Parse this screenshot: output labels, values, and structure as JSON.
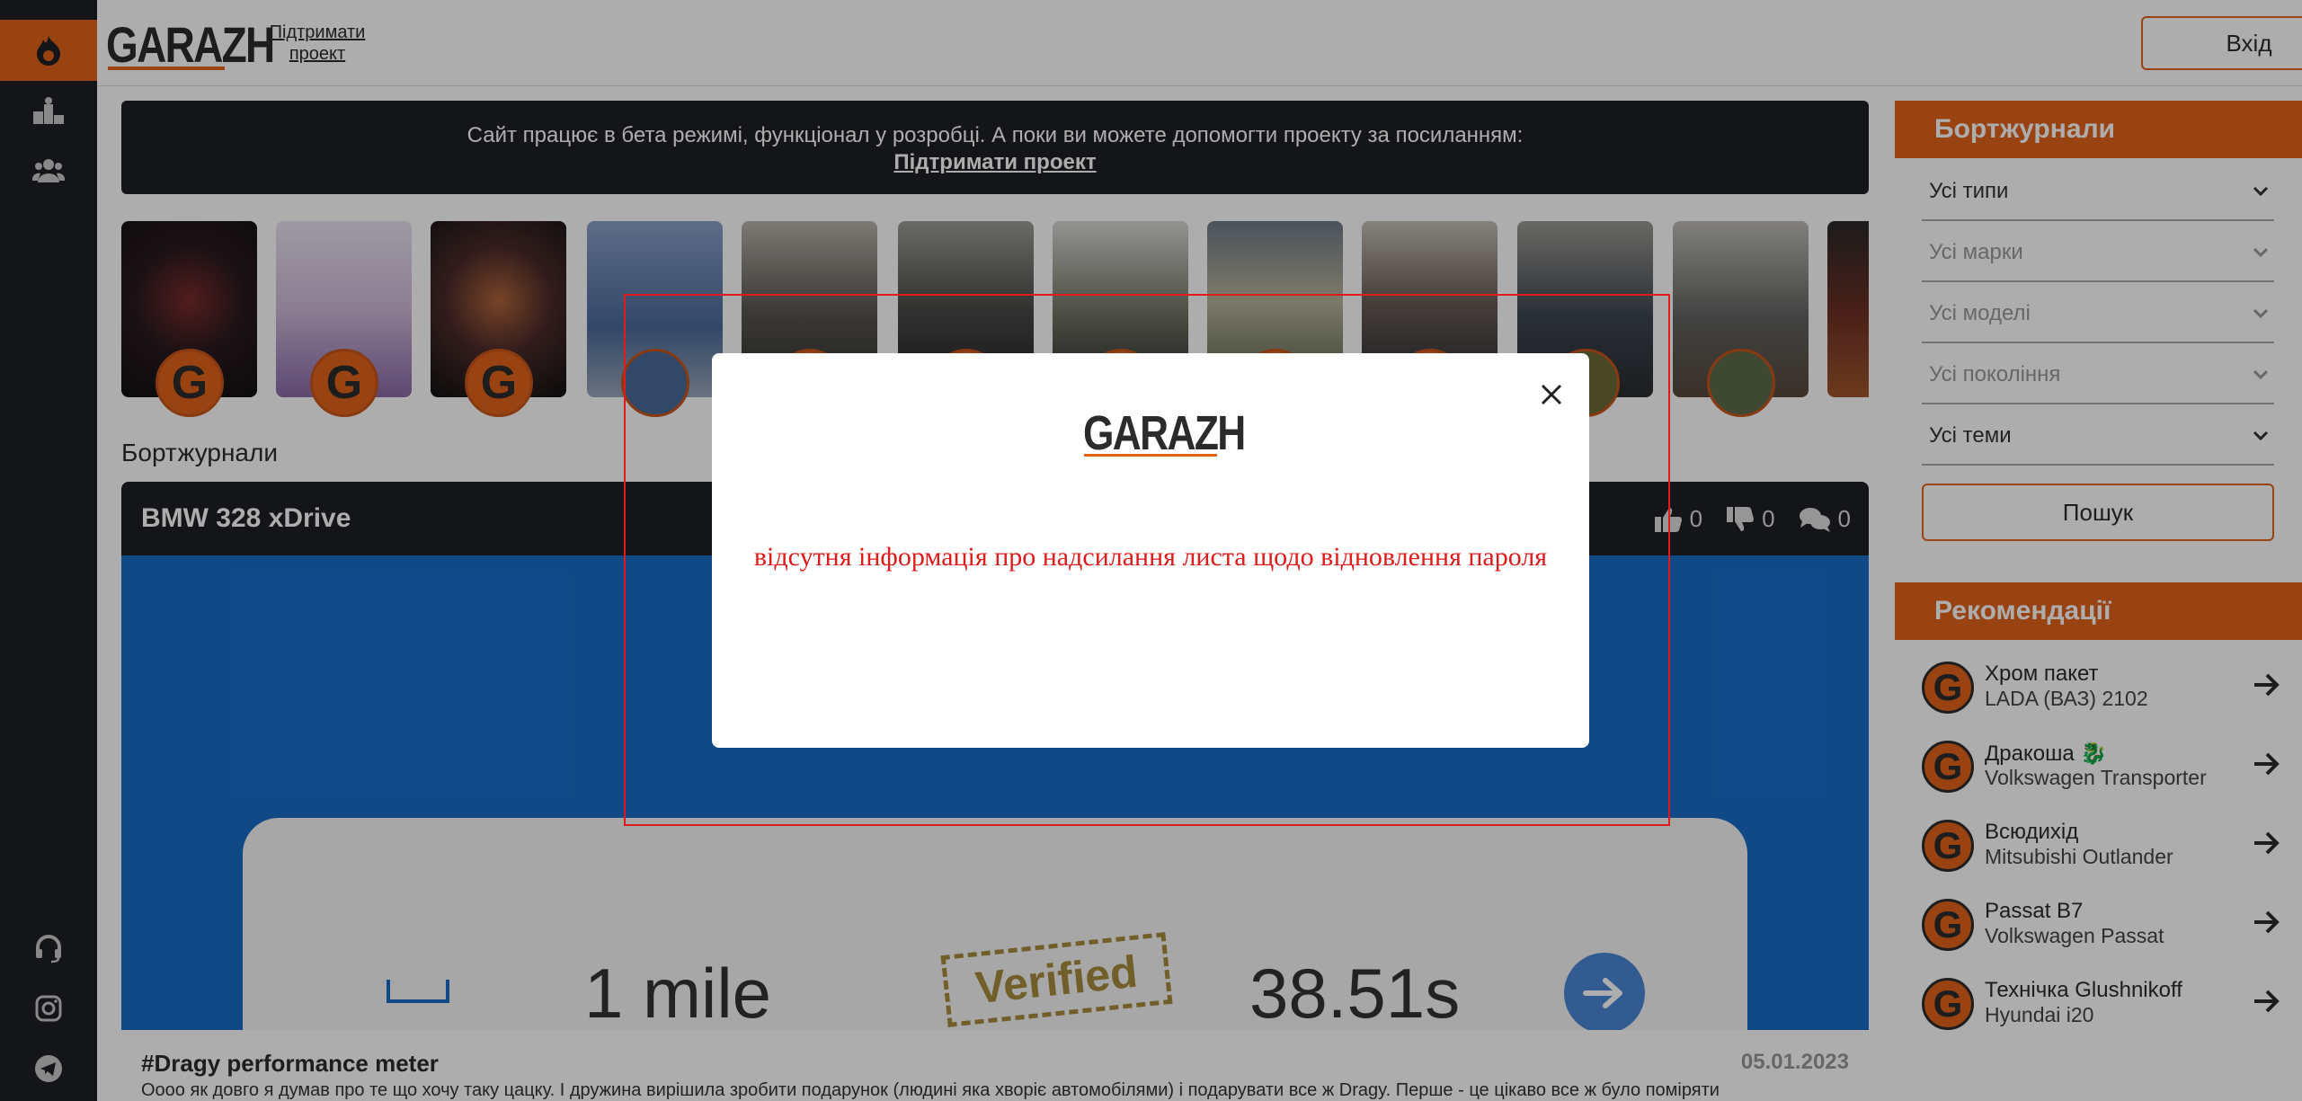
{
  "header": {
    "brand": "GARAZH",
    "support_link": "Підтримати проект",
    "login_button": "Вхід"
  },
  "nav_icons": [
    "fire-icon",
    "podium-icon",
    "users-icon",
    "headset-icon",
    "instagram-icon",
    "telegram-icon"
  ],
  "beta_notice": {
    "text": "Сайт працює в бета режимі, функціонал у розробці. А поки ви можете допомогти проекту за посиланням:",
    "link": "Підтримати проект"
  },
  "stories_avatar_letter": "G",
  "main": {
    "section_title": "Бортжурнали",
    "post": {
      "title": "BMW 328 xDrive",
      "likes": "0",
      "dislikes": "0",
      "comments": "0",
      "banner_distance": "1 mile",
      "banner_badge": "Verified",
      "banner_time": "38.51s",
      "tag": "#Dragy performance meter",
      "date": "05.01.2023",
      "excerpt": "Оооо як довго я думав про те що хочу таку цацку. І дружина вирішила зробити подарунок (людині яка хворіє автомобілями) і подарувати все ж Dragy. Перше - це цікаво все ж було поміряти"
    }
  },
  "sidebar": {
    "logbooks_title": "Бортжурнали",
    "filters": [
      "Усі типи",
      "Усі марки",
      "Усі моделі",
      "Усі покоління",
      "Усі теми"
    ],
    "search_button": "Пошук",
    "recommendations_title": "Рекомендації",
    "recommendations": [
      {
        "name": "Хром пакет",
        "model": "LADA (ВАЗ) 2102"
      },
      {
        "name": "Дракоша 🐉",
        "model": "Volkswagen Transporter"
      },
      {
        "name": "Всюдихід",
        "model": "Mitsubishi Outlander"
      },
      {
        "name": "Passat B7",
        "model": "Volkswagen Passat"
      },
      {
        "name": "Технічка Glushnikoff",
        "model": "Hyundai i20"
      }
    ]
  },
  "modal": {
    "brand": "GARAZH",
    "message": "відсутня інформація про надсилання листа щодо відновлення пароля"
  },
  "colors": {
    "accent": "#e2621b",
    "dark": "#1e1f24",
    "error": "#e01b1b"
  }
}
